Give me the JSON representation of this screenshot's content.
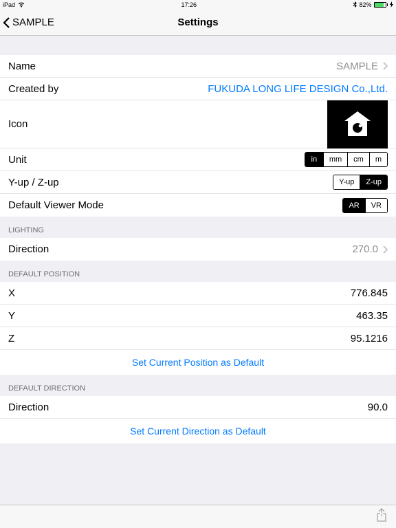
{
  "status": {
    "device": "iPad",
    "time": "17:26",
    "battery_pct": "82%"
  },
  "nav": {
    "back_label": "SAMPLE",
    "title": "Settings"
  },
  "general": {
    "name_label": "Name",
    "name_value": "SAMPLE",
    "created_by_label": "Created by",
    "created_by_value": "FUKUDA LONG LIFE DESIGN Co.,Ltd.",
    "icon_label": "Icon",
    "unit_label": "Unit",
    "unit_options": {
      "in": "in",
      "mm": "mm",
      "cm": "cm",
      "m": "m"
    },
    "unit_selected": "in",
    "yup_label": "Y-up / Z-up",
    "yup_options": {
      "yup": "Y-up",
      "zup": "Z-up"
    },
    "yup_selected": "Z-up",
    "viewer_label": "Default Viewer Mode",
    "viewer_options": {
      "ar": "AR",
      "vr": "VR"
    },
    "viewer_selected": "AR"
  },
  "lighting": {
    "header": "LIGHTING",
    "direction_label": "Direction",
    "direction_value": "270.0"
  },
  "position": {
    "header": "DEFAULT POSITION",
    "x_label": "X",
    "x_value": "776.845",
    "y_label": "Y",
    "y_value": "463.35",
    "z_label": "Z",
    "z_value": "95.1216",
    "action": "Set Current Position as Default"
  },
  "direction": {
    "header": "DEFAULT DIRECTION",
    "direction_label": "Direction",
    "direction_value": "90.0",
    "action": "Set Current Direction as Default"
  }
}
